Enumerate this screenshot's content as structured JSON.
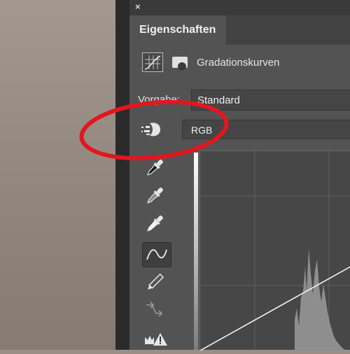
{
  "window": {
    "close_glyph": "×"
  },
  "tabs": [
    {
      "label": "Eigenschaften"
    }
  ],
  "properties": {
    "adjustment_icon": "curves-adjustment-icon",
    "mask_icon": "layer-mask-icon",
    "title": "Gradationskurven"
  },
  "preset": {
    "label": "Vorgabe:",
    "value": "Standard"
  },
  "channel": {
    "value": "RGB"
  },
  "tools": [
    {
      "name": "eyedropper-black-icon"
    },
    {
      "name": "eyedropper-gray-icon"
    },
    {
      "name": "eyedropper-white-icon"
    },
    {
      "name": "curve-points-icon",
      "active": true
    },
    {
      "name": "pencil-icon"
    },
    {
      "name": "smooth-curve-icon"
    },
    {
      "name": "clipping-warning-icon"
    }
  ],
  "annotation": {
    "color": "#e3161d"
  },
  "colors": {
    "panel": "#535353",
    "tab_bar": "#424242",
    "field": "#454545",
    "graph": "#474747"
  }
}
